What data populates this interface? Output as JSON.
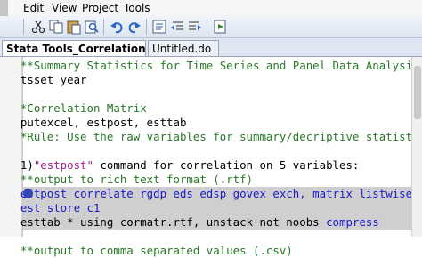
{
  "menu": {
    "partial_prev": "",
    "items": [
      "Edit",
      "View",
      "Project",
      "Tools"
    ]
  },
  "toolbar": {
    "icons": [
      "cut-icon",
      "copy-icon",
      "paste-icon",
      "find-icon",
      "undo-icon",
      "redo-icon",
      "comment-icon",
      "shift-left-icon",
      "shift-right-icon",
      "do-file-icon"
    ]
  },
  "tabs": [
    {
      "label": "Stata Tools_Correlation Matrix*",
      "close": "×"
    },
    {
      "label": "Untitled.do",
      "close": ""
    }
  ],
  "code": [
    {
      "parts": [
        {
          "t": "  **Summary Statistics for Time Series and Panel Data Analysis*",
          "c": "comment"
        }
      ]
    },
    {
      "parts": [
        {
          "t": "  tsset year",
          "c": "plain"
        }
      ]
    },
    {
      "parts": [
        {
          "t": "",
          "c": "plain"
        }
      ]
    },
    {
      "parts": [
        {
          "t": "  *Correlation Matrix",
          "c": "comment"
        }
      ]
    },
    {
      "parts": [
        {
          "t": "  putexcel, estpost, esttab",
          "c": "plain"
        }
      ]
    },
    {
      "parts": [
        {
          "t": "  *Rule: Use the raw variables for summary/decriptive statistics",
          "c": "comment"
        }
      ]
    },
    {
      "parts": [
        {
          "t": "",
          "c": "plain"
        }
      ]
    },
    {
      "parts": [
        {
          "t": "  1)",
          "c": "plain"
        },
        {
          "t": "\"estpost\"",
          "c": "str"
        },
        {
          "t": " command for correlation on 5 variables:",
          "c": "plain"
        }
      ]
    },
    {
      "parts": [
        {
          "t": "  **output to rich text format (.rtf)",
          "c": "comment"
        }
      ]
    },
    {
      "parts": [
        {
          "t": "  estpost ",
          "c": "kw"
        },
        {
          "t": "correlate rgdp eds edsp govex exch, matrix listwise",
          "c": "kw"
        }
      ],
      "highlight": true
    },
    {
      "parts": [
        {
          "t": "  est store c1",
          "c": "kw"
        }
      ],
      "highlight": true
    },
    {
      "parts": [
        {
          "t": "  esttab * using cormatr.rtf, unstack not noobs ",
          "c": "plain"
        },
        {
          "t": "compress",
          "c": "kw"
        }
      ],
      "highlight": true
    },
    {
      "parts": [
        {
          "t": "",
          "c": "plain"
        }
      ]
    },
    {
      "parts": [
        {
          "t": "  **output to comma separated values (.csv)",
          "c": "comment"
        }
      ]
    }
  ]
}
